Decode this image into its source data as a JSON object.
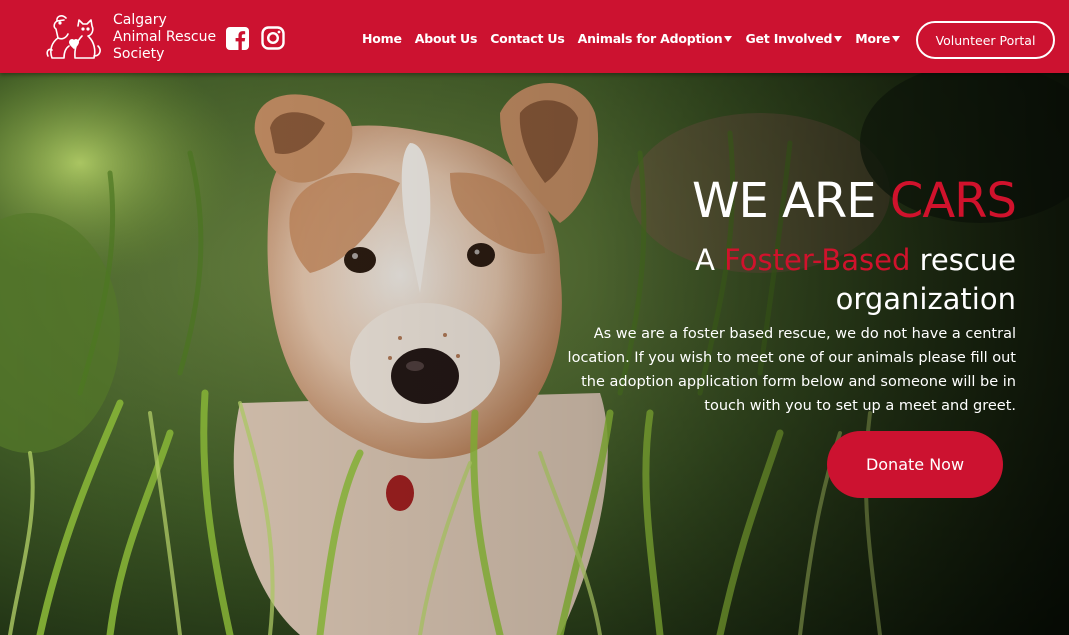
{
  "brand": {
    "name_lines": [
      "Calgary",
      "Animal Rescue",
      "Society"
    ],
    "logo_icon": "cat-dog-logo-icon"
  },
  "social": {
    "facebook_icon": "facebook-icon",
    "instagram_icon": "instagram-icon"
  },
  "nav": {
    "items": [
      {
        "label": "Home",
        "dropdown": false
      },
      {
        "label": "About Us",
        "dropdown": false
      },
      {
        "label": "Contact Us",
        "dropdown": false
      },
      {
        "label": "Animals for Adoption",
        "dropdown": true
      },
      {
        "label": "Get Involved",
        "dropdown": true
      },
      {
        "label": "More",
        "dropdown": true
      }
    ],
    "volunteer_label": "Volunteer Portal"
  },
  "hero": {
    "title_white": "WE ARE ",
    "title_red": "CARS",
    "sub_a": "A ",
    "sub_red": "Foster-Based",
    "sub_rest": " rescue organization",
    "description": "As we are a foster based rescue, we do not have a central location. If you wish to meet one of our animals please fill out the adoption application form below and someone will be in touch with you to set up a meet and greet.",
    "donate_label": "Donate Now"
  },
  "colors": {
    "brand_red": "#cc1230",
    "accent_red": "#d0122c",
    "text": "#ffffff"
  }
}
